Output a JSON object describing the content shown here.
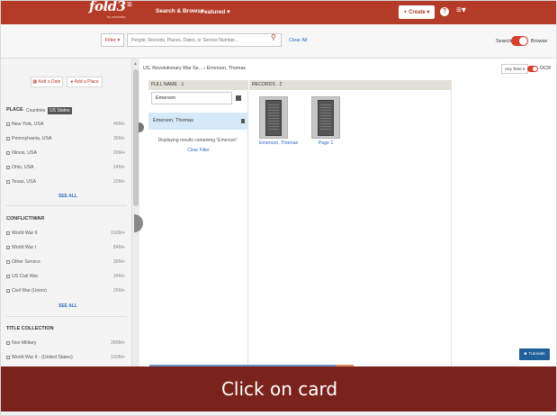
{
  "header": {
    "logo_text": "fold3",
    "logo_sub": "by ancestry",
    "nav_search_browse": "Search & Browse",
    "nav_featured": "Featured ▾",
    "create_label": "Create ▾",
    "help_label": "?",
    "brand_color": "#b43b27"
  },
  "search": {
    "filter_label": "Filter ▾",
    "placeholder": "People, Records, Places, Dates, or Service Number...",
    "clear_all": "Clear All",
    "mode_search": "Search",
    "mode_browse": "Browse"
  },
  "sidebar": {
    "add_date": "Add a Date",
    "add_place": "Add a Place",
    "place": {
      "heading": "PLACE",
      "tab_countries": "Countries",
      "tab_us_states": "US States",
      "items": [
        {
          "label": "New York, USA",
          "count": "46M+"
        },
        {
          "label": "Pennsylvania, USA",
          "count": "36M+"
        },
        {
          "label": "Illinois, USA",
          "count": "26M+"
        },
        {
          "label": "Ohio, USA",
          "count": "24M+"
        },
        {
          "label": "Texas, USA",
          "count": "22M+"
        }
      ],
      "see_all": "SEE ALL"
    },
    "conflict": {
      "heading": "CONFLICT/WAR",
      "items": [
        {
          "label": "World War II",
          "count": "160M+"
        },
        {
          "label": "World War I",
          "count": "84M+"
        },
        {
          "label": "Other Service",
          "count": "38M+"
        },
        {
          "label": "US Civil War",
          "count": "34M+"
        },
        {
          "label": "Civil War (Union)",
          "count": "25M+"
        }
      ],
      "see_all": "SEE ALL"
    },
    "title_collection": {
      "heading": "TITLE COLLECTION",
      "items": [
        {
          "label": "Non Military",
          "count": "280M+"
        },
        {
          "label": "World War II - (United States)",
          "count": "150M+"
        }
      ]
    }
  },
  "content": {
    "breadcrumb": "US, Revolutionary War Se...  ›  Emerson, Thomas",
    "any_time": "Any Time ▾",
    "ocr_label": "OCR",
    "full_name_header": "FULL NAME · 1",
    "records_header": "RECORDS · 2",
    "name_filter_value": "Emerson",
    "name_row": "Emerson, Thomas",
    "displaying": "Displaying results containing \"Emerson\".",
    "clear_filter": "Clear Filter",
    "records": [
      {
        "label": "Emerson, Thomas"
      },
      {
        "label": "Page 1"
      }
    ],
    "tutorials": "Tutorials"
  },
  "caption": "Click on card"
}
